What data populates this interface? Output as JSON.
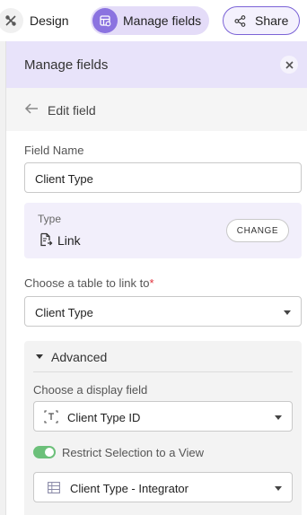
{
  "toolbar": {
    "design_label": "Design",
    "manage_fields_label": "Manage fields",
    "share_label": "Share"
  },
  "panel": {
    "title": "Manage fields",
    "back_label": "Edit field",
    "field_name": {
      "label": "Field Name",
      "value": "Client Type"
    },
    "type": {
      "label": "Type",
      "value": "Link",
      "icon": "link-document-icon",
      "change_label": "CHANGE"
    },
    "link_table": {
      "label": "Choose a table to link to",
      "required_mark": "*",
      "value": "Client Type"
    },
    "advanced": {
      "label": "Advanced",
      "display_field": {
        "label": "Choose a display field",
        "value": "Client Type ID",
        "icon": "text-type-icon"
      },
      "restrict_toggle": {
        "label": "Restrict Selection to a View",
        "on": true
      },
      "view": {
        "value": "Client Type - Integrator",
        "icon": "grid-view-icon"
      }
    }
  },
  "colors": {
    "accent": "#8b73e0",
    "header_bg": "#e8e3fa",
    "toggle_on": "#6cc07a",
    "required": "#e0313b"
  }
}
